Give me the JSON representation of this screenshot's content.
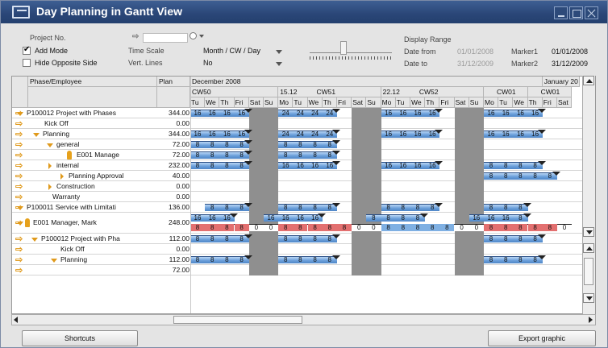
{
  "window": {
    "title": "Day Planning in Gantt View"
  },
  "params": {
    "project_no_label": "Project No.",
    "add_mode_label": "Add Mode",
    "add_mode_checked": true,
    "hide_opposite_label": "Hide Opposite Side",
    "hide_opposite_checked": false,
    "time_scale_label": "Time Scale",
    "time_scale_value": "Month / CW / Day",
    "vert_lines_label": "Vert. Lines",
    "vert_lines_value": "No",
    "display_range_label": "Display Range",
    "date_from_label": "Date from",
    "date_from_value": "01/01/2008",
    "date_to_label": "Date to",
    "date_to_value": "31/12/2009",
    "marker1_label": "Marker1",
    "marker1_value": "01/01/2008",
    "marker2_label": "Marker2",
    "marker2_value": "31/12/2009"
  },
  "grid": {
    "col_phase": "Phase/Employee",
    "col_plan": "Plan",
    "months": [
      "December 2008",
      "January 20"
    ],
    "weeks": [
      {
        "date": "",
        "cw": "CW50"
      },
      {
        "date": "15.12",
        "cw": "CW51"
      },
      {
        "date": "22.12",
        "cw": "CW52"
      },
      {
        "date": "",
        "cw": "CW01"
      },
      {
        "date": "",
        "cw": "CW01"
      }
    ],
    "days": [
      "Tu",
      "We",
      "Th",
      "Fri",
      "Sat",
      "Su",
      "Mo",
      "Tu",
      "We",
      "Th",
      "Fri",
      "Sat",
      "Su",
      "Mo",
      "Tu",
      "We",
      "Th",
      "Fri",
      "Sat",
      "Su",
      "Mo",
      "Tu",
      "We",
      "Th",
      "Fri",
      "Sat"
    ],
    "rows": [
      {
        "name": "P100012  Project with Phases",
        "plan": "344.00",
        "vals": [
          "16",
          "16",
          "16",
          "16",
          "",
          "",
          "24",
          "24",
          "24",
          "24",
          "",
          "",
          "",
          "16",
          "16",
          "16",
          "16",
          "",
          "",
          "",
          "16",
          "16",
          "16",
          "16"
        ]
      },
      {
        "name": "Kick Off",
        "plan": "0.00",
        "vals": []
      },
      {
        "name": "Planning",
        "plan": "344.00",
        "vals": [
          "16",
          "16",
          "16",
          "16",
          "",
          "",
          "24",
          "24",
          "24",
          "24",
          "",
          "",
          "",
          "16",
          "16",
          "16",
          "16",
          "",
          "",
          "",
          "16",
          "16",
          "16",
          "16"
        ]
      },
      {
        "name": "general",
        "plan": "72.00",
        "vals": [
          "8",
          "8",
          "8",
          "8",
          "",
          "",
          "8",
          "8",
          "8",
          "8"
        ]
      },
      {
        "name": "E001 Manage",
        "plan": "72.00",
        "vals": [
          "8",
          "8",
          "8",
          "8",
          "",
          "",
          "8",
          "8",
          "8",
          "8"
        ]
      },
      {
        "name": "internal",
        "plan": "232.00",
        "vals": [
          "8",
          "8",
          "8",
          "8",
          "",
          "",
          "16",
          "16",
          "16",
          "16",
          "",
          "",
          "",
          "16",
          "16",
          "16",
          "16",
          "",
          "",
          "",
          "8",
          "8",
          "8",
          "8"
        ]
      },
      {
        "name": "Planning Approval",
        "plan": "40.00",
        "vals": [
          "8",
          "8",
          "8",
          "8",
          "8"
        ]
      },
      {
        "name": "Construction",
        "plan": "0.00",
        "vals": []
      },
      {
        "name": "Warranty",
        "plan": "0.00",
        "vals": []
      },
      {
        "name": "P100011  Service with Limitati",
        "plan": "136.00",
        "vals": [
          "8",
          "8",
          "8",
          "",
          "",
          "8",
          "8",
          "8",
          "8",
          "",
          "",
          "",
          "8",
          "8",
          "8",
          "8",
          "",
          "",
          "",
          "8",
          "8",
          "8"
        ]
      },
      {
        "name": "E001 Manager, Mark",
        "plan": "248.00",
        "vals_top": [
          "16",
          "16",
          "16",
          "",
          "",
          "16",
          "16",
          "16",
          "16",
          "",
          "",
          "",
          "8",
          "8",
          "8",
          "8",
          "",
          "",
          "",
          "16",
          "16",
          "16",
          "8"
        ],
        "vals_bottom": [
          "8",
          "8",
          "8",
          "8",
          "0",
          "0",
          "8",
          "8",
          "8",
          "8",
          "8",
          "0",
          "0",
          "8",
          "8",
          "8",
          "8",
          "8",
          "0",
          "0",
          "8",
          "8",
          "8",
          "8",
          "8",
          "0"
        ]
      },
      {
        "name": "P100012  Project with Pha",
        "plan": "112.00",
        "vals": [
          "8",
          "8",
          "8",
          "8",
          "",
          "",
          "8",
          "8",
          "8",
          "8",
          "",
          "",
          "",
          "",
          "",
          "",
          "",
          "",
          "",
          "",
          "8",
          "8",
          "8",
          "8"
        ]
      },
      {
        "name": "Kick Off",
        "plan": "0.00",
        "vals": []
      },
      {
        "name": "Planning",
        "plan": "112.00",
        "vals": [
          "8",
          "8",
          "8",
          "8",
          "",
          "",
          "8",
          "8",
          "8",
          "8",
          "",
          "",
          "",
          "",
          "",
          "",
          "",
          "",
          "",
          "",
          "8",
          "8",
          "8",
          "8"
        ]
      },
      {
        "name": "",
        "plan": "72.00",
        "vals": []
      }
    ]
  },
  "footer": {
    "shortcuts_label": "Shortcuts",
    "export_label": "Export graphic"
  }
}
